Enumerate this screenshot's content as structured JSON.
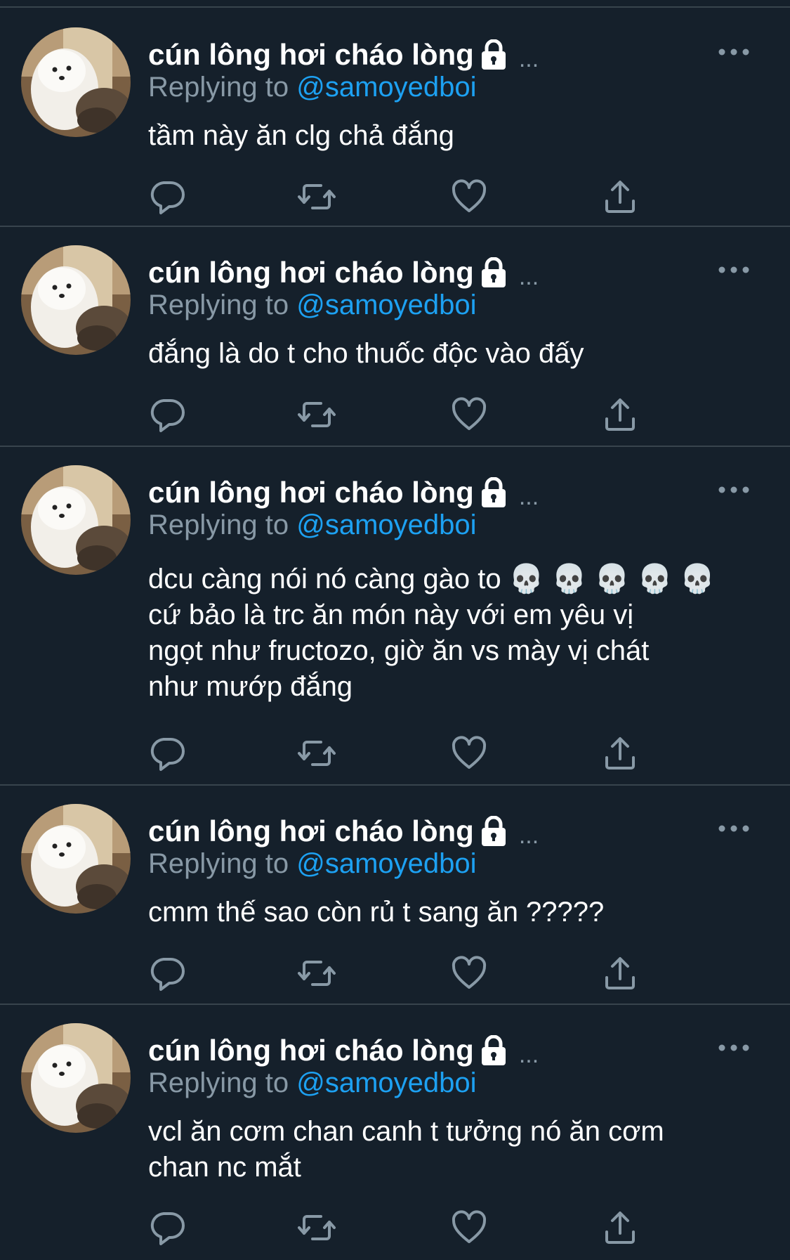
{
  "colors": {
    "background": "#15202b",
    "divider": "#38444d",
    "secondary_text": "#8899a6",
    "accent": "#1da1f2",
    "primary_text": "#ffffff"
  },
  "tweets": [
    {
      "display_name": "cún lông hơi cháo lòng",
      "ellipsis": "...",
      "reply_prefix": "Replying to",
      "reply_handle": "@samoyedboi",
      "text": "tầm này ăn clg chả đắng"
    },
    {
      "display_name": "cún lông hơi cháo lòng",
      "ellipsis": "...",
      "reply_prefix": "Replying to",
      "reply_handle": "@samoyedboi",
      "text": "đắng là do t cho thuốc độc vào đấy"
    },
    {
      "display_name": "cún lông hơi cháo lòng",
      "ellipsis": "...",
      "reply_prefix": "Replying to",
      "reply_handle": "@samoyedboi",
      "text": "dcu càng nói nó càng gào to 💀 💀 💀 💀 💀\ncứ bảo là trc ăn món này với em yêu vị\nngọt như fructozo, giờ ăn vs mày vị chát\nnhư mướp đắng"
    },
    {
      "display_name": "cún lông hơi cháo lòng",
      "ellipsis": "...",
      "reply_prefix": "Replying to",
      "reply_handle": "@samoyedboi",
      "text": "cmm thế sao còn rủ t sang ăn ?????"
    },
    {
      "display_name": "cún lông hơi cháo lòng",
      "ellipsis": "...",
      "reply_prefix": "Replying to",
      "reply_handle": "@samoyedboi",
      "text": "vcl ăn cơm chan canh t tưởng nó ăn cơm\nchan nc mắt"
    }
  ],
  "icons": {
    "lock": "lock-icon",
    "more": "more-icon",
    "reply": "reply-icon",
    "retweet": "retweet-icon",
    "like": "heart-icon",
    "share": "share-icon"
  }
}
